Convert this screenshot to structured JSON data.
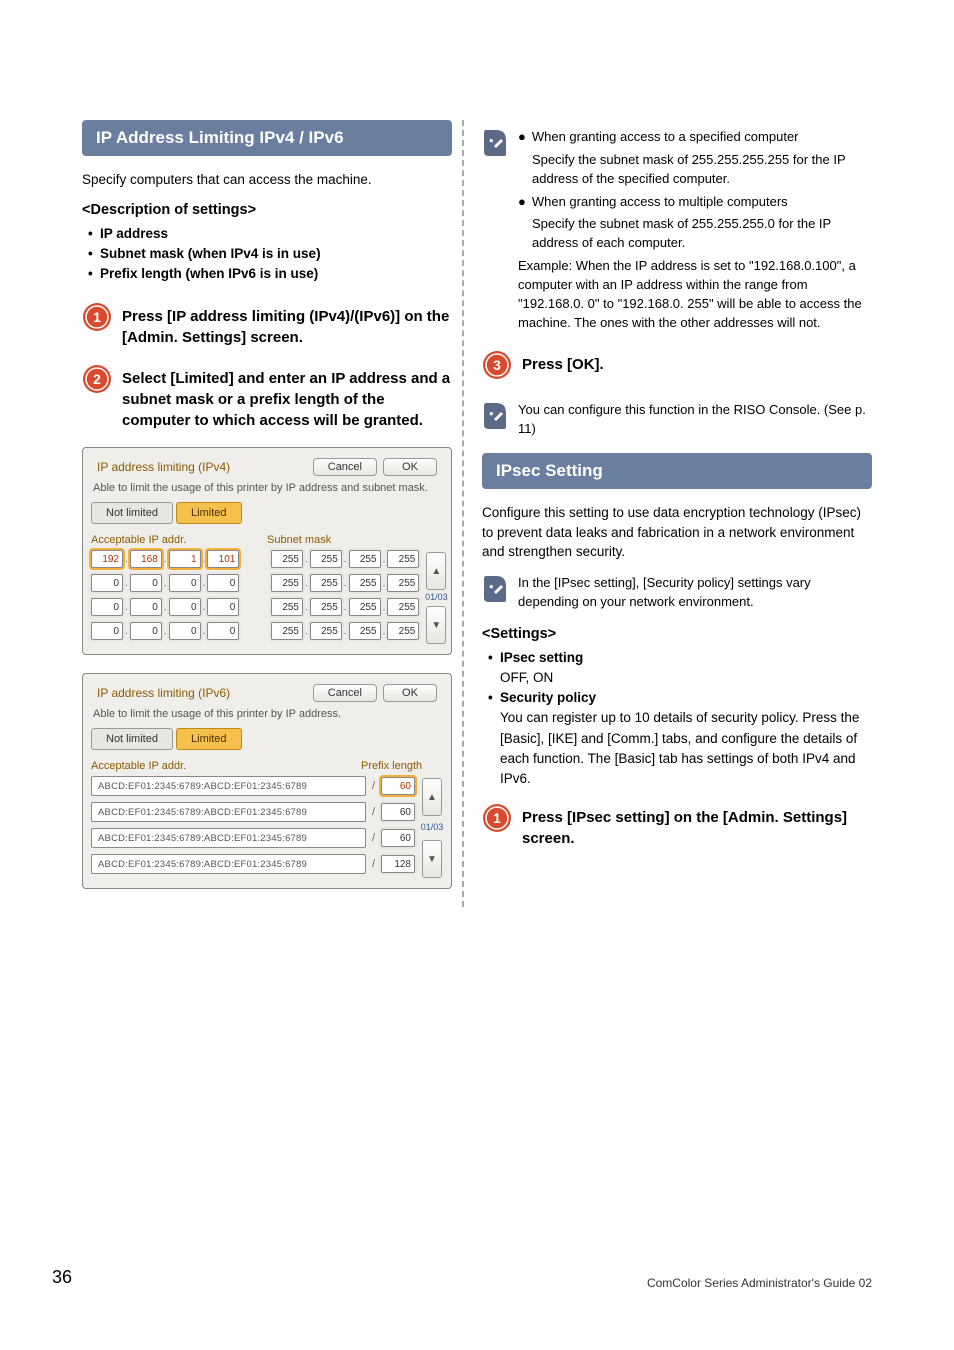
{
  "page_number": "36",
  "footer": "ComColor Series  Administrator's Guide 02",
  "left": {
    "heading": "IP Address Limiting IPv4 / IPv6",
    "intro": "Specify computers that can access the machine.",
    "desc_title": "<Description of settings>",
    "desc_items": [
      "IP address",
      "Subnet mask (when IPv4 is in use)",
      "Prefix length (when IPv6 is in use)"
    ],
    "step1": "Press [IP address limiting (IPv4)/(IPv6)] on the [Admin. Settings] screen.",
    "step2": "Select [Limited] and enter an IP address and a subnet mask or a prefix length of the computer to which access will be granted."
  },
  "shot_v4": {
    "title": "IP address limiting (IPv4)",
    "cancel": "Cancel",
    "ok": "OK",
    "desc": "Able to limit the usage of this printer by IP address and subnet mask.",
    "not_limited": "Not limited",
    "limited": "Limited",
    "col_ip": "Acceptable IP addr.",
    "col_mask": "Subnet mask",
    "rows": [
      {
        "ip": [
          "192",
          "168",
          "1",
          "101"
        ],
        "mask": [
          "255",
          "255",
          "255",
          "255"
        ],
        "hi": true
      },
      {
        "ip": [
          "0",
          "0",
          "0",
          "0"
        ],
        "mask": [
          "255",
          "255",
          "255",
          "255"
        ],
        "hi": false
      },
      {
        "ip": [
          "0",
          "0",
          "0",
          "0"
        ],
        "mask": [
          "255",
          "255",
          "255",
          "255"
        ],
        "hi": false
      },
      {
        "ip": [
          "0",
          "0",
          "0",
          "0"
        ],
        "mask": [
          "255",
          "255",
          "255",
          "255"
        ],
        "hi": false
      }
    ],
    "page_ind": "01/03"
  },
  "shot_v6": {
    "title": "IP address limiting (IPv6)",
    "cancel": "Cancel",
    "ok": "OK",
    "desc": "Able to limit the usage of this printer by IP address.",
    "not_limited": "Not limited",
    "limited": "Limited",
    "col_ip": "Acceptable IP addr.",
    "col_plen": "Prefix length",
    "rows": [
      {
        "addr": "ABCD:EF01:2345:6789:ABCD:EF01:2345:6789",
        "plen": "60",
        "hi": true
      },
      {
        "addr": "ABCD:EF01:2345:6789:ABCD:EF01:2345:6789",
        "plen": "60",
        "hi": false
      },
      {
        "addr": "ABCD:EF01:2345:6789:ABCD:EF01:2345:6789",
        "plen": "60",
        "hi": false
      },
      {
        "addr": "ABCD:EF01:2345:6789:ABCD:EF01:2345:6789",
        "plen": "128",
        "hi": false
      }
    ],
    "page_ind": "01/03"
  },
  "right": {
    "note1_b1_head": "When granting access to a specified computer",
    "note1_b1_body": "Specify the subnet mask of 255.255.255.255 for the IP address of the specified computer.",
    "note1_b2_head": "When granting access to multiple computers",
    "note1_b2_body": "Specify the subnet mask of 255.255.255.0 for the IP address of each computer.",
    "note1_example": "Example: When the IP address is set to \"192.168.0.100\", a computer with an IP address within the range from \"192.168.0. 0\" to \"192.168.0. 255\" will be able to access the machine. The ones with the other addresses will not.",
    "step3": "Press [OK].",
    "note2": "You can configure this function in the RISO Console. (See p. 11)",
    "ipsec_heading": "IPsec Setting",
    "ipsec_intro": "Configure this setting to use data encryption technology (IPsec) to prevent data leaks and fabrication in a network environment and strengthen security.",
    "ipsec_note": "In the [IPsec setting], [Security policy] settings vary depending on your network environment.",
    "settings_title": "<Settings>",
    "setting1_name": "IPsec setting",
    "setting1_vals": "OFF, ON",
    "setting2_name": "Security policy",
    "setting2_body": "You can register up to 10 details of security policy. Press the [Basic], [IKE] and [Comm.] tabs, and configure the details of each function. The [Basic] tab has settings of both IPv4 and IPv6.",
    "ipsec_step1": "Press [IPsec setting] on the [Admin. Settings] screen."
  }
}
